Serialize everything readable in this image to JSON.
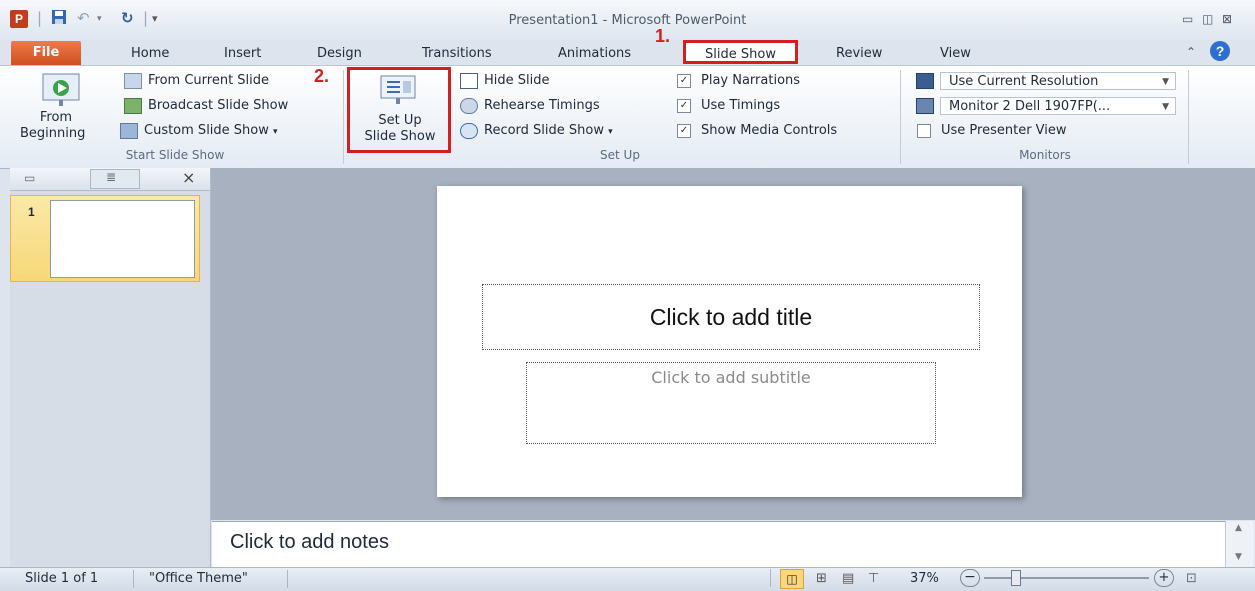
{
  "window": {
    "title": "Presentation1 - Microsoft PowerPoint",
    "app_icon_letter": "P"
  },
  "quick_access": {
    "save_icon": "save-icon",
    "undo_icon": "undo-icon",
    "redo_icon": "redo-icon"
  },
  "tabs": [
    "File",
    "Home",
    "Insert",
    "Design",
    "Transitions",
    "Animations",
    "Slide Show",
    "Review",
    "View"
  ],
  "annotations": {
    "step1": "1.",
    "step2": "2."
  },
  "ribbon": {
    "start_group": {
      "from_beginning_line1": "From",
      "from_beginning_line2": "Beginning",
      "from_current": "From Current Slide",
      "broadcast": "Broadcast Slide Show",
      "custom": "Custom Slide Show",
      "label": "Start Slide Show"
    },
    "setup_group": {
      "setup_line1": "Set Up",
      "setup_line2": "Slide Show",
      "hide_slide": "Hide Slide",
      "rehearse": "Rehearse Timings",
      "record": "Record Slide Show",
      "play_narrations": "Play Narrations",
      "use_timings": "Use Timings",
      "show_media": "Show Media Controls",
      "label": "Set Up"
    },
    "monitors_group": {
      "resolution": "Use Current Resolution",
      "monitor": "Monitor 2 Dell 1907FP(...",
      "presenter_view": "Use Presenter View",
      "label": "Monitors"
    }
  },
  "slides_pane": {
    "slide_number": "1",
    "close": "×"
  },
  "slide": {
    "title_placeholder": "Click to add title",
    "subtitle_placeholder": "Click to add subtitle"
  },
  "notes": {
    "placeholder": "Click to add notes"
  },
  "status": {
    "slide_info": "Slide 1 of 1",
    "theme": "\"Office Theme\"",
    "zoom": "37%"
  },
  "colors": {
    "file_tab": "#d04e1f",
    "annotation": "#d31f1f",
    "ribbon_bg": "#e4ebf4"
  }
}
